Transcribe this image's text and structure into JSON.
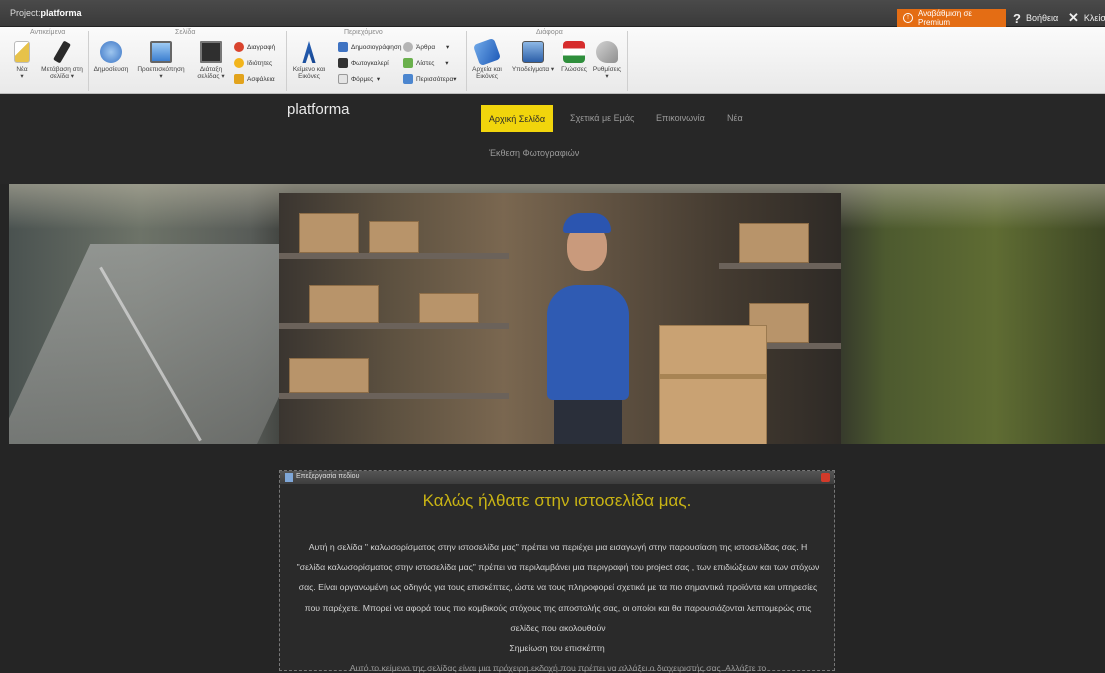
{
  "titlebar": {
    "project_prefix": "Project:",
    "project_name": "platforma",
    "premium_label": "Αναβάθμιση σε Premium",
    "help_label": "Βοήθεια",
    "close_label": "Κλείσιμο"
  },
  "ribbon": {
    "groups": {
      "objects": "Αντικείμενα",
      "page": "Σελίδα",
      "content": "Περιεχόμενο",
      "misc": "Διάφορα"
    },
    "buttons": {
      "new": "Νέα",
      "goto_page": "Μετάβαση στη σελίδα",
      "publish": "Δημοσίευση",
      "preview": "Προεπισκόπηση",
      "layout": "Διάταξη σελίδας",
      "delete": "Διαγραφή",
      "properties": "Ιδιότητες",
      "security": "Ασφάλεια",
      "text_images": "Κείμενο και Εικόνες",
      "blog": "Δημοσιογράφηση",
      "gallery": "Φωτογκαλερί",
      "forms": "Φόρμες",
      "articles": "Άρθρα",
      "lists": "Λίστες",
      "more": "Περισσότερα",
      "files_images": "Αρχεία και Εικόνες",
      "templates": "Υποδείγματα",
      "languages": "Γλώσσες",
      "settings": "Ρυθμίσεις"
    }
  },
  "site": {
    "logo": "platforma",
    "nav": {
      "home": "Αρχική Σελίδα",
      "about": "Σχετικά με Εμάς",
      "contact": "Επικοινωνία",
      "news": "Νέα",
      "gallery": "Έκθεση Φωτογραφιών"
    }
  },
  "editor": {
    "bar_label": "Επεξεργασία πεδίου",
    "heading": "Καλώς ήλθατε στην ιστοσελίδα μας.",
    "paragraph": "Αυτή η σελίδα \" καλωσορίσματος στην ιστοσελίδα μας\" πρέπει να περιέχει μια εισαγωγή στην παρουσίαση της ιστοσελίδας σας. Η \"σελίδα καλωσορίσματος στην ιστοσελίδα μας\" πρέπει να περιλαμβάνει μια περιγραφή του project σας , των επιδιώξεων και των στόχων σας. Είναι οργανωμένη ως οδηγός για τους επισκέπτες, ώστε να τους πληροφορεί σχετικά με τα πιο σημαντικά προϊόντα και υπηρεσίες που παρέχετε. Μπορεί να αφορά τους πιο κομβικούς στόχους της αποστολής σας, οι οποίοι και θα παρουσιάζονται λεπτομερώς στις σελίδες που ακολουθούν",
    "note_title": "Σημείωση του επισκέπτη",
    "note_text": "Αυτό το κείμενο της σελίδας είναι μια πρόχειρη εκδοχή που πρέπει να αλλάξει ο διαχειριστής σας. Αλλάξτε το"
  },
  "colors": {
    "accent": "#f1d50c",
    "premium": "#e46d14",
    "heading": "#c9b414"
  }
}
